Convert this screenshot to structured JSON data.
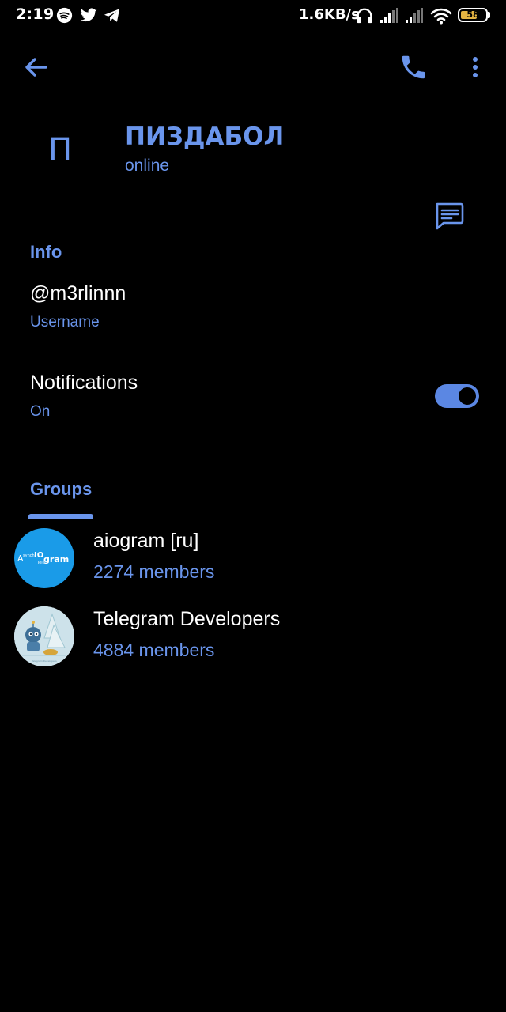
{
  "status_bar": {
    "time": "2:19",
    "network_speed": "1.6KB/s",
    "battery": "58",
    "left_icons": [
      "spotify-icon",
      "twitter-icon",
      "telegram-icon"
    ],
    "right_icons": [
      "headphones-icon",
      "signal-icon",
      "signal-icon",
      "wifi-icon",
      "battery-icon"
    ]
  },
  "toolbar": {
    "back_icon": "arrow-left-icon",
    "call_icon": "phone-icon",
    "more_icon": "more-vertical-icon"
  },
  "profile": {
    "avatar_letter": "П",
    "name": "ПИЗДАБОЛ",
    "status": "online",
    "message_icon": "message-icon"
  },
  "info": {
    "title": "Info",
    "username_value": "@m3rlinnn",
    "username_caption": "Username",
    "notifications_label": "Notifications",
    "notifications_status": "On",
    "notifications_enabled": true
  },
  "groups_tab": {
    "label": "Groups"
  },
  "groups": [
    {
      "name": "aiogram [ru]",
      "members": "2274 members"
    },
    {
      "name": "Telegram Developers",
      "members": "4884 members"
    }
  ],
  "colors": {
    "accent": "#6a95ec",
    "background": "#000000",
    "text": "#ffffff",
    "aiogram_avatar": "#1a9be8"
  }
}
